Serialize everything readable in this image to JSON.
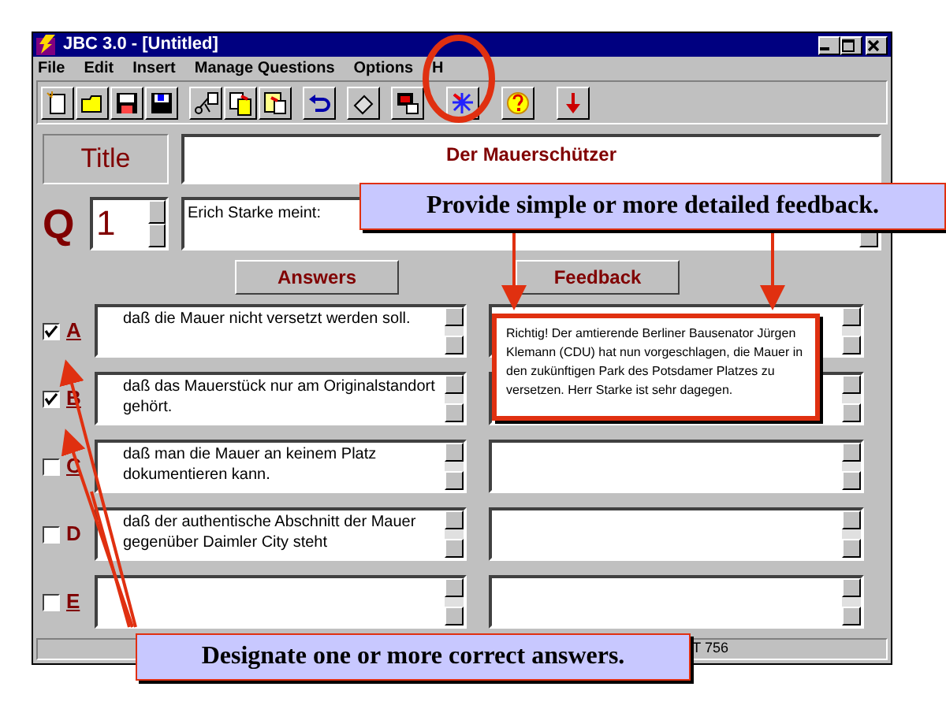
{
  "window": {
    "title": "JBC 3.0 - [Untitled]"
  },
  "menu": [
    "File",
    "Edit",
    "Insert",
    "Manage Questions",
    "Options",
    "H"
  ],
  "title_label": "Title",
  "title_value": "Der Mauerschützer",
  "question": {
    "label": "Q",
    "number": "1",
    "text": "Erich Starke meint:"
  },
  "headers": {
    "answers": "Answers",
    "feedback": "Feedback"
  },
  "answers": [
    {
      "letter": "A",
      "checked": true,
      "text": "daß die Mauer nicht versetzt werden soll.",
      "feedback": "Richtig!  Der amtierende Berliner Bausenator Jürgen Klemann (CDU) hat nun vorgeschlagen, die Mauer in den zukünftigen Park des Potsdamer Platzes  zu versetzen. Herr Starke ist sehr dagegen."
    },
    {
      "letter": "B",
      "checked": true,
      "text": "daß das Mauerstück nur am Originalstandort gehört."
    },
    {
      "letter": "C",
      "checked": false,
      "text": "daß man die Mauer an keinem Platz dokumentieren kann."
    },
    {
      "letter": "D",
      "checked": false,
      "text": "daß der authentische Abschnitt der Mauer gegenüber Daimler City steht"
    },
    {
      "letter": "E",
      "checked": false
    }
  ],
  "status_bar": "T 756",
  "callouts": {
    "top": "Provide simple or more detailed feedback.",
    "bottom": "Designate one or more correct answers."
  }
}
